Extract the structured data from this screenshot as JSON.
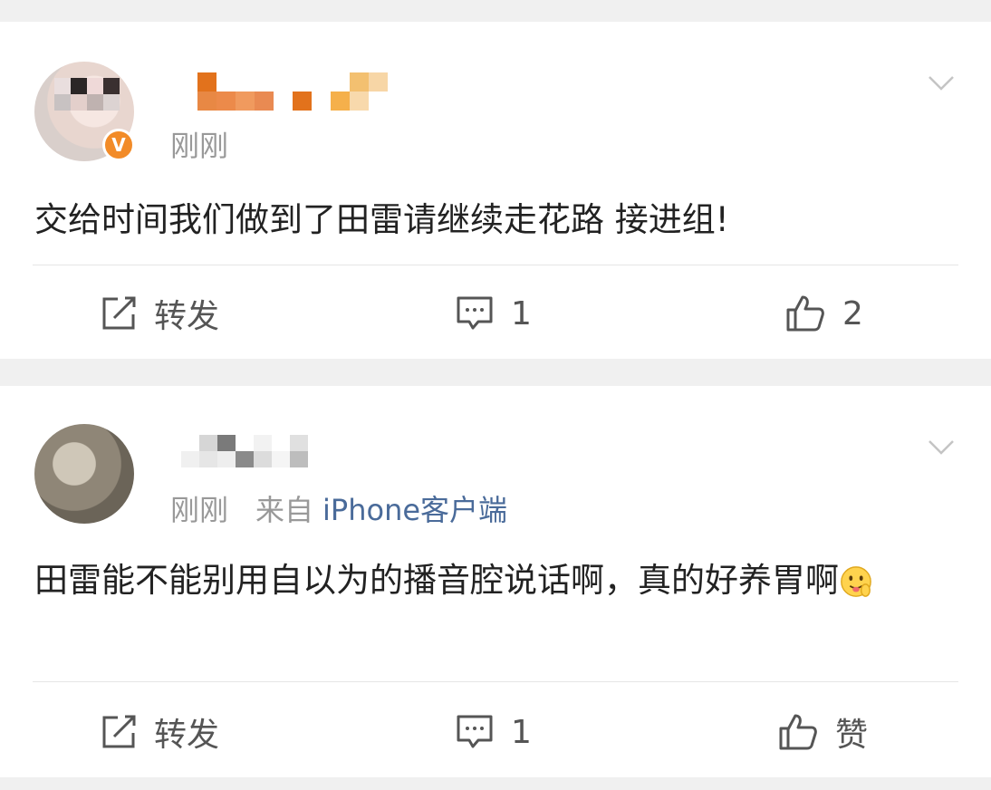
{
  "posts": [
    {
      "time": "刚刚",
      "source_prefix": "",
      "source_client": "",
      "verified": true,
      "verified_badge": "V",
      "content": "交给时间我们做到了田雷请继续走花路 接进组!",
      "actions": {
        "repost": "转发",
        "comment_count": "1",
        "like": "2"
      }
    },
    {
      "time": "刚刚",
      "source_prefix": "来自",
      "source_client": "iPhone客户端",
      "verified": false,
      "content": "田雷能不能别用自以为的播音腔说话啊，真的好养胃啊",
      "emoji": "tongue-face-emoji",
      "actions": {
        "repost": "转发",
        "comment_count": "1",
        "like": "赞"
      }
    }
  ],
  "colors": {
    "background": "#f0f0f0",
    "card": "#ffffff",
    "meta_text": "#999999",
    "link_blue": "#4a6b9a",
    "badge_orange": "#f28b28"
  },
  "icons": [
    "chevron-down-icon",
    "repost-icon",
    "comment-icon",
    "thumbs-up-icon"
  ]
}
